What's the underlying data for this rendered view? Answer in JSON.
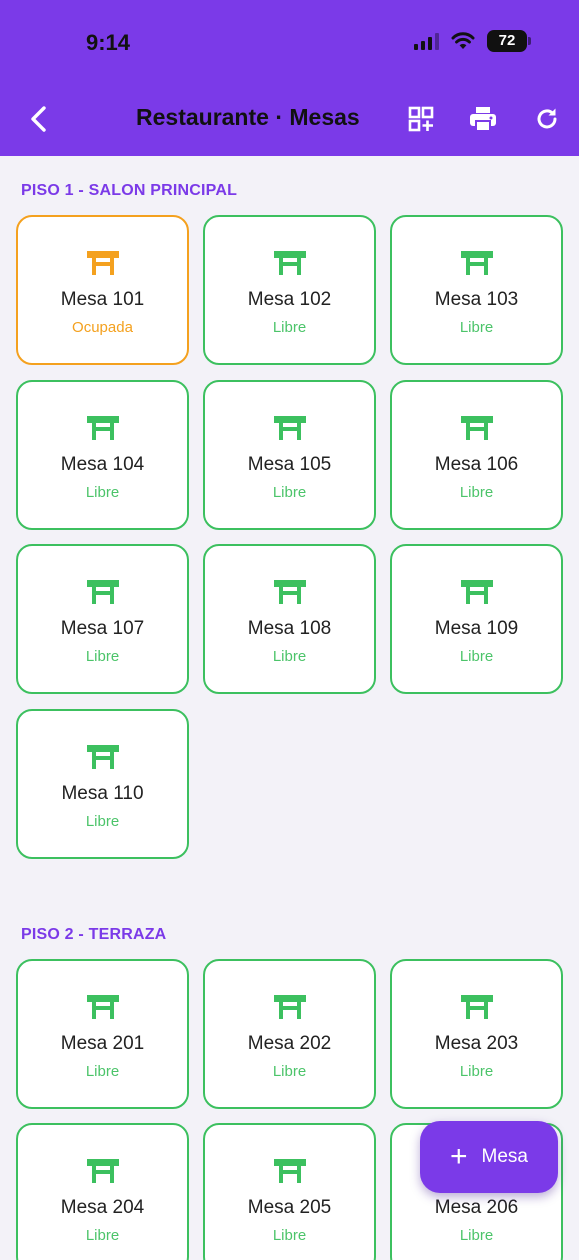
{
  "status_bar": {
    "time": "9:14",
    "battery": "72"
  },
  "app_bar": {
    "title": "Restaurante · Mesas"
  },
  "sections": [
    {
      "title": "PISO 1 - SALON PRINCIPAL",
      "tables": [
        {
          "name": "Mesa 101",
          "state": "Ocupada"
        },
        {
          "name": "Mesa 102",
          "state": "Libre"
        },
        {
          "name": "Mesa 103",
          "state": "Libre"
        },
        {
          "name": "Mesa 104",
          "state": "Libre"
        },
        {
          "name": "Mesa 105",
          "state": "Libre"
        },
        {
          "name": "Mesa 106",
          "state": "Libre"
        },
        {
          "name": "Mesa 107",
          "state": "Libre"
        },
        {
          "name": "Mesa 108",
          "state": "Libre"
        },
        {
          "name": "Mesa 109",
          "state": "Libre"
        },
        {
          "name": "Mesa 110",
          "state": "Libre"
        }
      ]
    },
    {
      "title": "PISO 2 - TERRAZA",
      "tables": [
        {
          "name": "Mesa 201",
          "state": "Libre"
        },
        {
          "name": "Mesa 202",
          "state": "Libre"
        },
        {
          "name": "Mesa 203",
          "state": "Libre"
        },
        {
          "name": "Mesa 204",
          "state": "Libre"
        },
        {
          "name": "Mesa 205",
          "state": "Libre"
        },
        {
          "name": "Mesa 206",
          "state": "Libre"
        }
      ]
    }
  ],
  "fab": {
    "label": "Mesa",
    "icon": "plus-icon"
  },
  "colors": {
    "primary": "#7b3ae8",
    "free": "#3cc05f",
    "occupied": "#f4a11f"
  }
}
